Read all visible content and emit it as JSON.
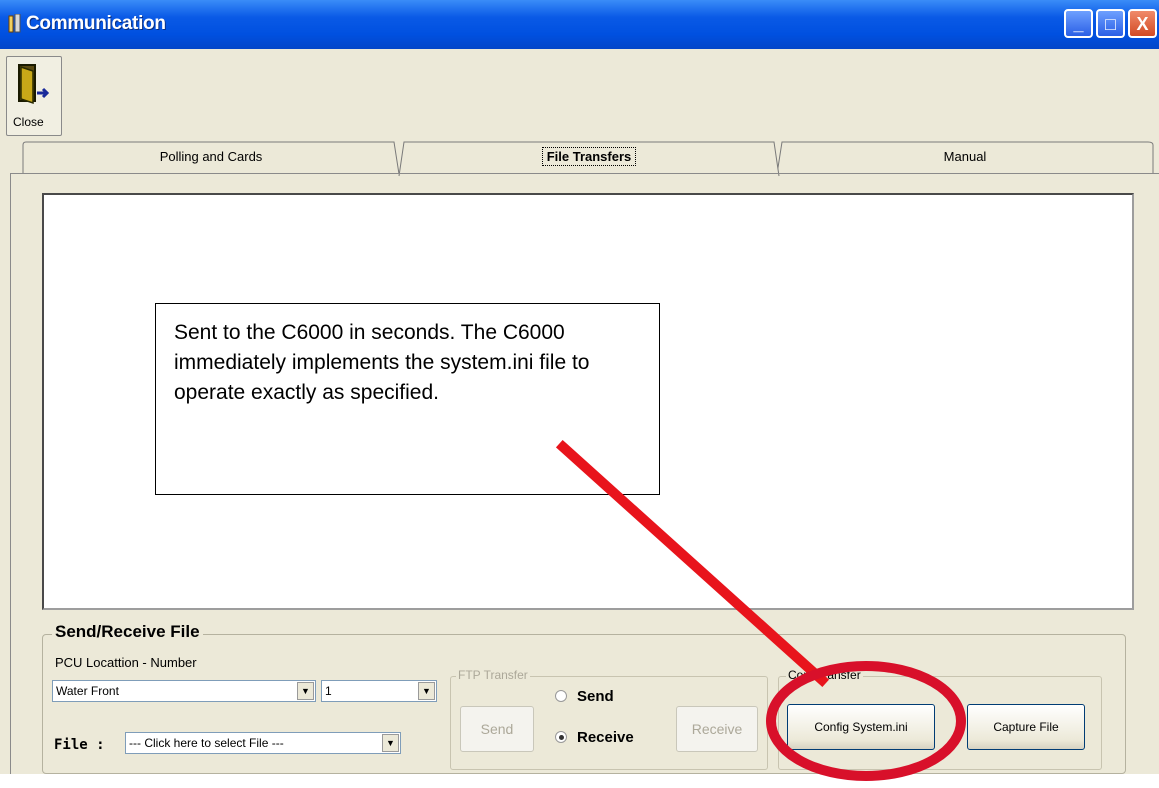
{
  "window": {
    "title": "Communication",
    "app_icon": "pcu-app-icon"
  },
  "window_controls": {
    "minimize": "_",
    "maximize": "□",
    "close": "X"
  },
  "toolbar": {
    "close_label": "Close",
    "close_icon": "exit-door-icon"
  },
  "tabs": [
    {
      "label": "Polling and Cards",
      "active": false
    },
    {
      "label": "File Transfers",
      "active": true
    },
    {
      "label": "Manual",
      "active": false
    }
  ],
  "callout": {
    "text": "Sent to the C6000 in seconds. The C6000 immediately implements the system.ini file to operate exactly as specified."
  },
  "send_receive": {
    "title": "Send/Receive File",
    "pcu_label": "PCU Locattion - Number",
    "location_value": "Water Front",
    "number_value": "1",
    "file_label": "File :",
    "file_value": "--- Click here to select File ---"
  },
  "ftp": {
    "title": "FTP Transfer",
    "send_button": "Send",
    "receive_button": "Receive",
    "radio_send": "Send",
    "radio_receive": "Receive",
    "selected": "Receive"
  },
  "com_transfer": {
    "title": "Com Transfer",
    "config_button": "Config System.ini",
    "capture_button": "Capture File"
  },
  "annotation_colors": {
    "arrow": "#e8141c",
    "circle": "#d8102a"
  }
}
